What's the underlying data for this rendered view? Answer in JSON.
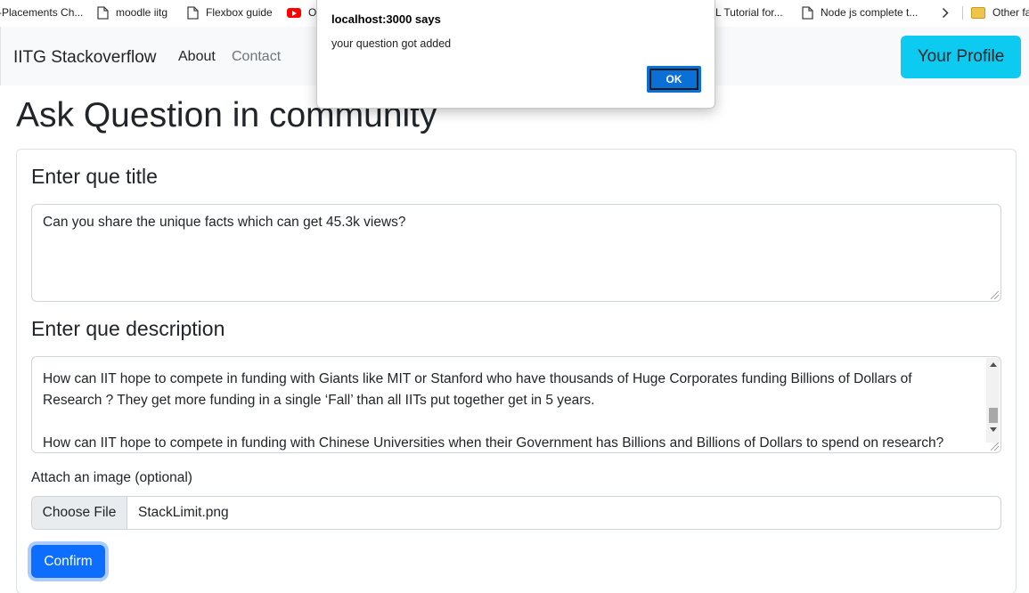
{
  "bookmarks": [
    {
      "label": "-Placements Ch...",
      "icon": "none"
    },
    {
      "label": "moodle iitg",
      "icon": "page-icon"
    },
    {
      "label": "Flexbox guide",
      "icon": "page-icon"
    },
    {
      "label": "O",
      "icon": "youtube-icon"
    },
    {
      "label": "L Tutorial for...",
      "icon": "none"
    },
    {
      "label": "Node js complete t...",
      "icon": "page-icon"
    },
    {
      "label": "Other fa",
      "icon": "folder-icon"
    }
  ],
  "navbar": {
    "brand": "IITG Stackoverflow",
    "links": [
      "About",
      "Contact"
    ],
    "profile_button": "Your Profile",
    "profile_color": "#0dcaf0"
  },
  "page": {
    "title": "Ask Question in community",
    "title_label": "Enter que title",
    "title_value": "Can you share the unique facts which can get 45.3k views?",
    "description_label": "Enter que description",
    "description_lines": [
      "How can IIT hope to compete in funding with Giants like MIT or Stanford who have thousands of Huge Corporates funding Billions of Dollars of",
      "Research ? They get more funding in a single ‘Fall’ than all IITs put together get in 5 years.",
      "",
      "How can IIT hope to compete in funding with Chinese Universities when their Government has Billions and Billions of Dollars to spend on research?"
    ],
    "attach_label": "Attach an image (optional)",
    "file_button": "Choose File",
    "file_name": "StackLimit.png",
    "confirm_button": "Confirm",
    "confirm_color": "#0d6efd"
  },
  "dialog": {
    "title": "localhost:3000 says",
    "message": "your question got added",
    "ok_label": "OK",
    "ok_color": "#0b6fd8"
  }
}
